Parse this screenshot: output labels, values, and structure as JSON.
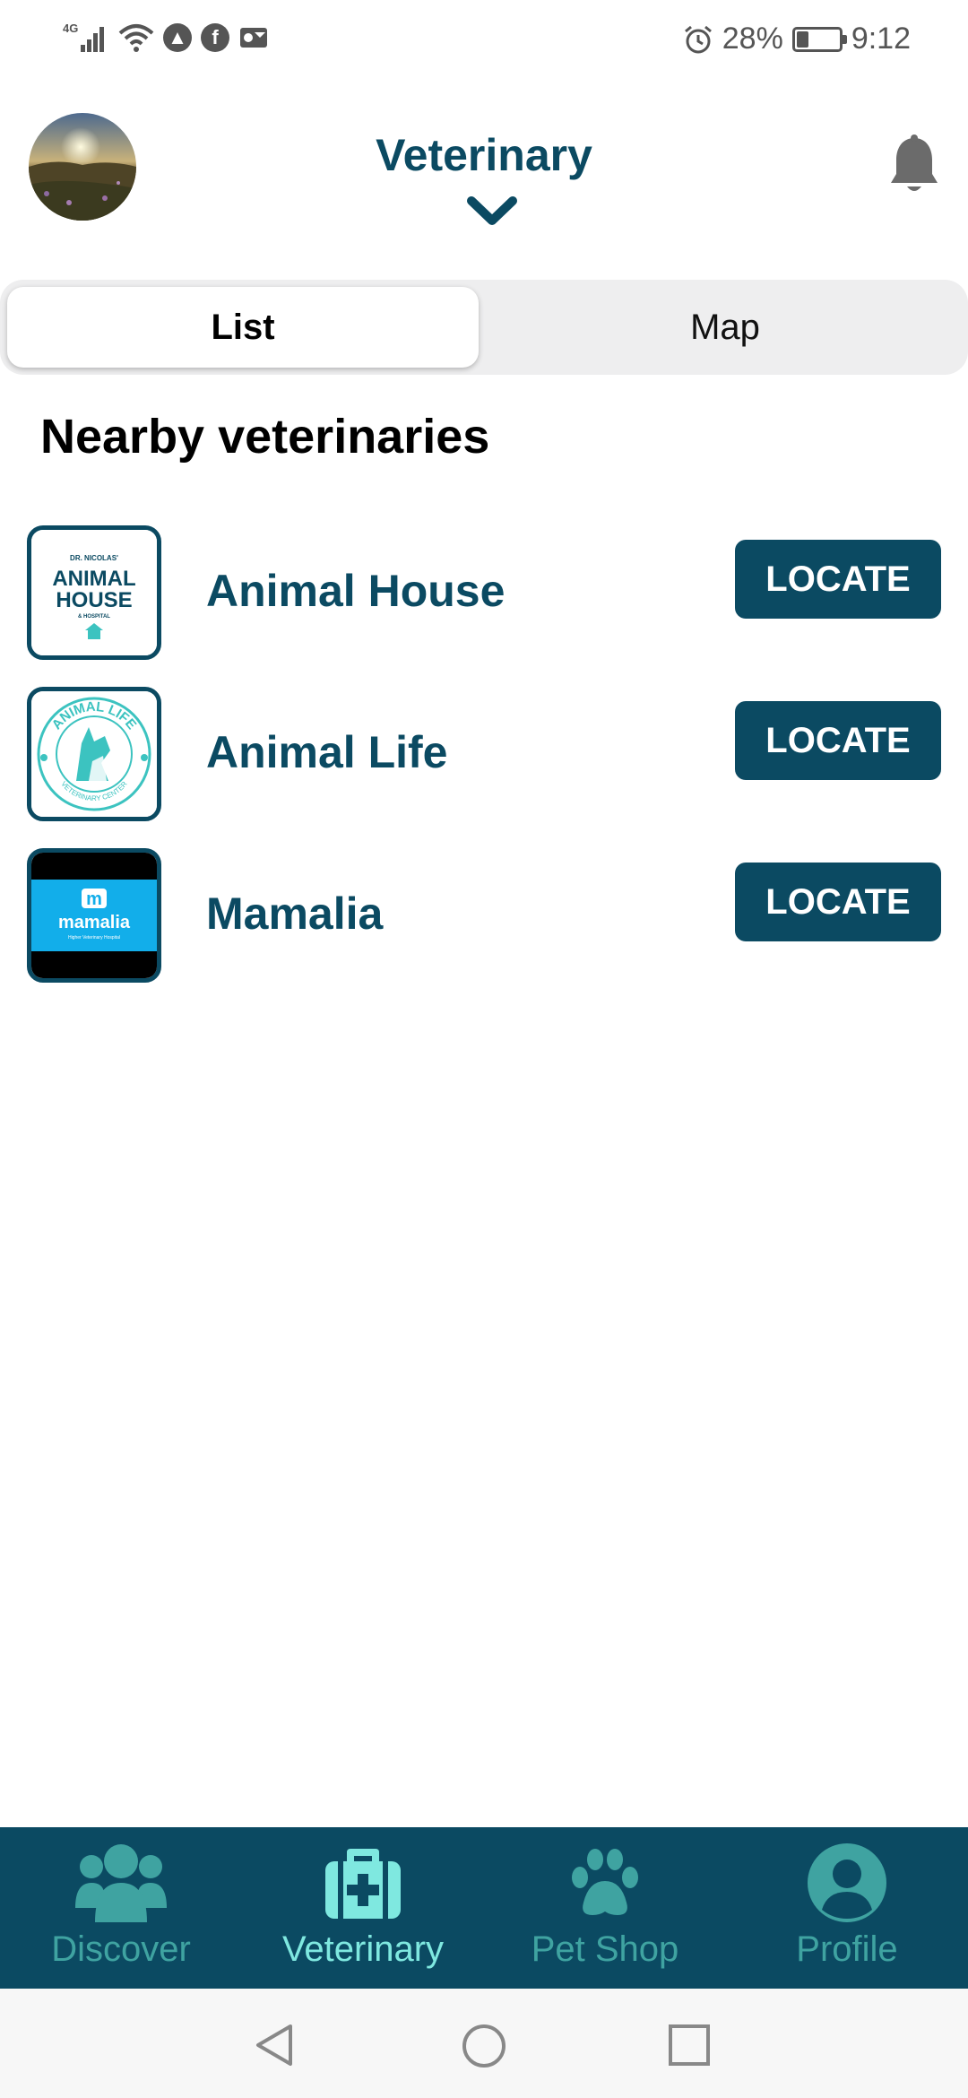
{
  "status_bar": {
    "network": "4G",
    "battery": "28%",
    "battery_level": 0.28,
    "time": "9:12"
  },
  "header": {
    "title": "Veterinary",
    "avatar": "avatar-photo",
    "bell_icon": "bell-icon",
    "chevron_icon": "chevron-down-icon"
  },
  "segmented": {
    "list_label": "List",
    "map_label": "Map",
    "selected": "List"
  },
  "section": {
    "title": "Nearby veterinaries"
  },
  "vets": [
    {
      "name": "Animal House",
      "button": "LOCATE",
      "logo": {
        "top_text": "DR. NICOLAS'",
        "line1": "ANIMAL",
        "line2": "HOUSE",
        "bottom_text": "& HOSPITAL"
      }
    },
    {
      "name": "Animal Life",
      "button": "LOCATE",
      "logo": {
        "top_text": "ANIMAL LIFE",
        "bottom_text": "VETERINARY CENTER"
      }
    },
    {
      "name": "Mamalia",
      "button": "LOCATE",
      "logo": {
        "mark": "m",
        "text": "mamalia",
        "subtext": "Higher Veterinary Hospital"
      }
    }
  ],
  "bottom_nav": {
    "items": [
      {
        "label": "Discover",
        "icon": "users-icon"
      },
      {
        "label": "Veterinary",
        "icon": "medical-kit-icon",
        "active": true
      },
      {
        "label": "Pet Shop",
        "icon": "paw-icon"
      },
      {
        "label": "Profile",
        "icon": "user-circle-icon"
      }
    ]
  },
  "colors": {
    "primary": "#0b4a62",
    "accent": "#7fe8e0",
    "nav_inactive": "#3fa3a1"
  }
}
